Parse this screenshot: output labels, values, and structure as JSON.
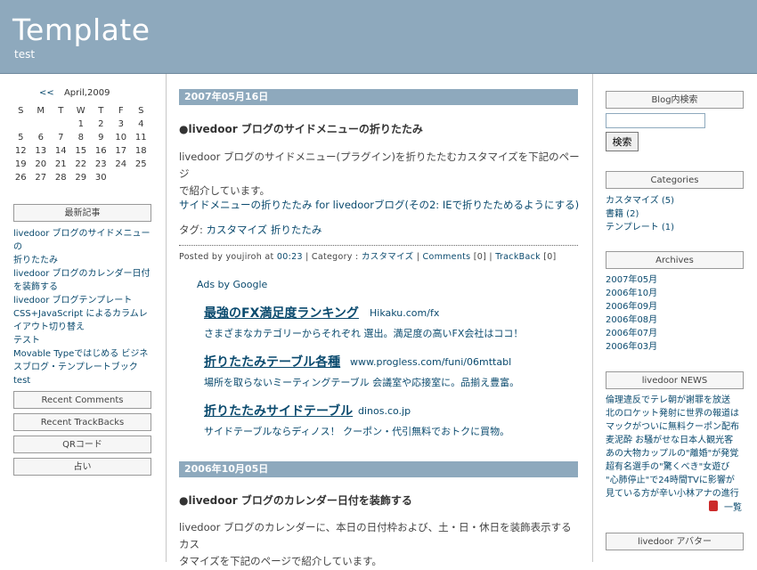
{
  "header": {
    "title": "Template",
    "subtitle": "test"
  },
  "calendar": {
    "prev": "<<",
    "month": "April,2009",
    "weekdays": [
      "S",
      "M",
      "T",
      "W",
      "T",
      "F",
      "S"
    ],
    "weeks": [
      [
        "",
        "",
        "",
        "1",
        "2",
        "3",
        "4"
      ],
      [
        "5",
        "6",
        "7",
        "8",
        "9",
        "10",
        "11"
      ],
      [
        "12",
        "13",
        "14",
        "15",
        "16",
        "17",
        "18"
      ],
      [
        "19",
        "20",
        "21",
        "22",
        "23",
        "24",
        "25"
      ],
      [
        "26",
        "27",
        "28",
        "29",
        "30",
        "",
        ""
      ]
    ]
  },
  "left": {
    "recent_title": "最新記事",
    "recent_items": [
      "livedoor ブログのサイドメニューの",
      "折りたたみ",
      "livedoor ブログのカレンダー日付",
      "を装飾する",
      "livedoor ブログテンプレート",
      "CSS+JavaScript によるカラムレ",
      "イアウト切り替え",
      "テスト",
      "Movable Typeではじめる ビジネ",
      "スブログ・テンプレートブック",
      "test"
    ],
    "boxes": [
      "Recent Comments",
      "Recent TrackBacks",
      "QRコード",
      "占い"
    ]
  },
  "entry1": {
    "date": "2007年05月16日",
    "title": "●livedoor ブログのサイドメニューの折りたたみ",
    "body_line1": "livedoor ブログのサイドメニュー(プラグイン)を折りたたむカスタマイズを下記のページ",
    "body_line2": "で紹介しています。",
    "link": "サイドメニューの折りたたみ for livedoorブログ(その2: IEで折りたためるようにする)",
    "tag_label": "タグ: ",
    "tag1": "カスタマイズ",
    "tag2": "折りたたみ",
    "posted_by": "Posted by youjiroh at ",
    "time": "00:23",
    "category_label": " | Category : ",
    "category": "カスタマイズ",
    "comments": "Comments",
    "comments_count": " [0] | ",
    "trackback": "TrackBack",
    "trackback_count": " [0]"
  },
  "ads": {
    "label": "Ads by Google",
    "items": [
      {
        "title": "最強のFX満足度ランキング",
        "url": "Hikaku.com/fx",
        "desc": "さまざまなカテゴリーからそれぞれ 選出。満足度の高いFX会社はココ！"
      },
      {
        "title": "折りたたみテーブル各種",
        "url": "www.progless.com/funi/06mttabl",
        "desc": "場所を取らないミーティングテーブル 会議室や応接室に。品揃え豊富。"
      },
      {
        "title": "折りたたみサイドテーブル",
        "url": "dinos.co.jp",
        "desc": "サイドテーブルならディノス！ クーポン・代引無料でおトクに買物。"
      }
    ]
  },
  "entry2": {
    "date": "2006年10月05日",
    "title": "●livedoor ブログのカレンダー日付を装飾する",
    "body_line1": "livedoor ブログのカレンダーに、本日の日付枠および、土・日・休日を装飾表示するカス",
    "body_line2": "タマイズを下記のページで紹介しています。"
  },
  "right": {
    "search_title": "Blog内検索",
    "search_value": "",
    "search_button": "検索",
    "categories_title": "Categories",
    "categories": [
      "カスタマイズ (5)",
      "書籍 (2)",
      "テンプレート (1)"
    ],
    "archives_title": "Archives",
    "archives": [
      "2007年05月",
      "2006年10月",
      "2006年09月",
      "2006年08月",
      "2006年07月",
      "2006年03月"
    ],
    "news_title": "livedoor NEWS",
    "news": [
      "倫理違反でテレ朝が謝罪を放送",
      "北のロケット発射に世界の報道は",
      "マックがついに無料クーポン配布",
      "麦泥酔 お騒がせな日本人観光客",
      "あの大物カップルの\"離婚\"が発覚",
      "超有名選手の\"驚くべき\"女遊び",
      "\"心肺停止\"で24時間TVに影響が",
      "見ている方が辛い小林アナの進行"
    ],
    "news_more": "一覧",
    "avatar_title": "livedoor アバター"
  }
}
